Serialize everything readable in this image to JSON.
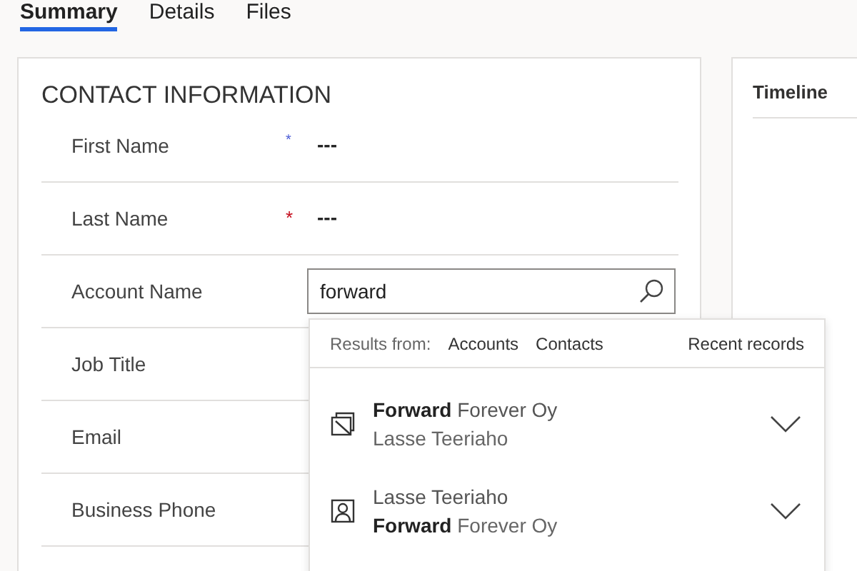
{
  "tabs": [
    {
      "label": "Summary",
      "selected": true
    },
    {
      "label": "Details",
      "selected": false
    },
    {
      "label": "Files",
      "selected": false
    }
  ],
  "contact_section": {
    "title": "CONTACT INFORMATION",
    "fields": [
      {
        "kind": "text",
        "label": "First Name",
        "marker": {
          "kind": "recommended",
          "text": "*"
        },
        "value": "---"
      },
      {
        "kind": "text",
        "label": "Last Name",
        "marker": {
          "kind": "required",
          "text": "*"
        },
        "value": "---"
      },
      {
        "kind": "lookup",
        "label": "Account Name",
        "value": "forward"
      },
      {
        "kind": "text",
        "label": "Job Title"
      },
      {
        "kind": "text",
        "label": "Email"
      },
      {
        "kind": "text",
        "label": "Business Phone"
      }
    ]
  },
  "timeline": {
    "title": "Timeline"
  },
  "lookup_dropdown": {
    "results_from_label": "Results from:",
    "filters": [
      "Accounts",
      "Contacts"
    ],
    "recent_records": "Recent records",
    "results": [
      {
        "kind": "account",
        "primary": "**Forward** Forever Oy",
        "secondary": "Lasse Teeriaho"
      },
      {
        "kind": "contact",
        "primary": "Lasse Teeriaho",
        "secondary": "**Forward** Forever Oy"
      }
    ]
  }
}
